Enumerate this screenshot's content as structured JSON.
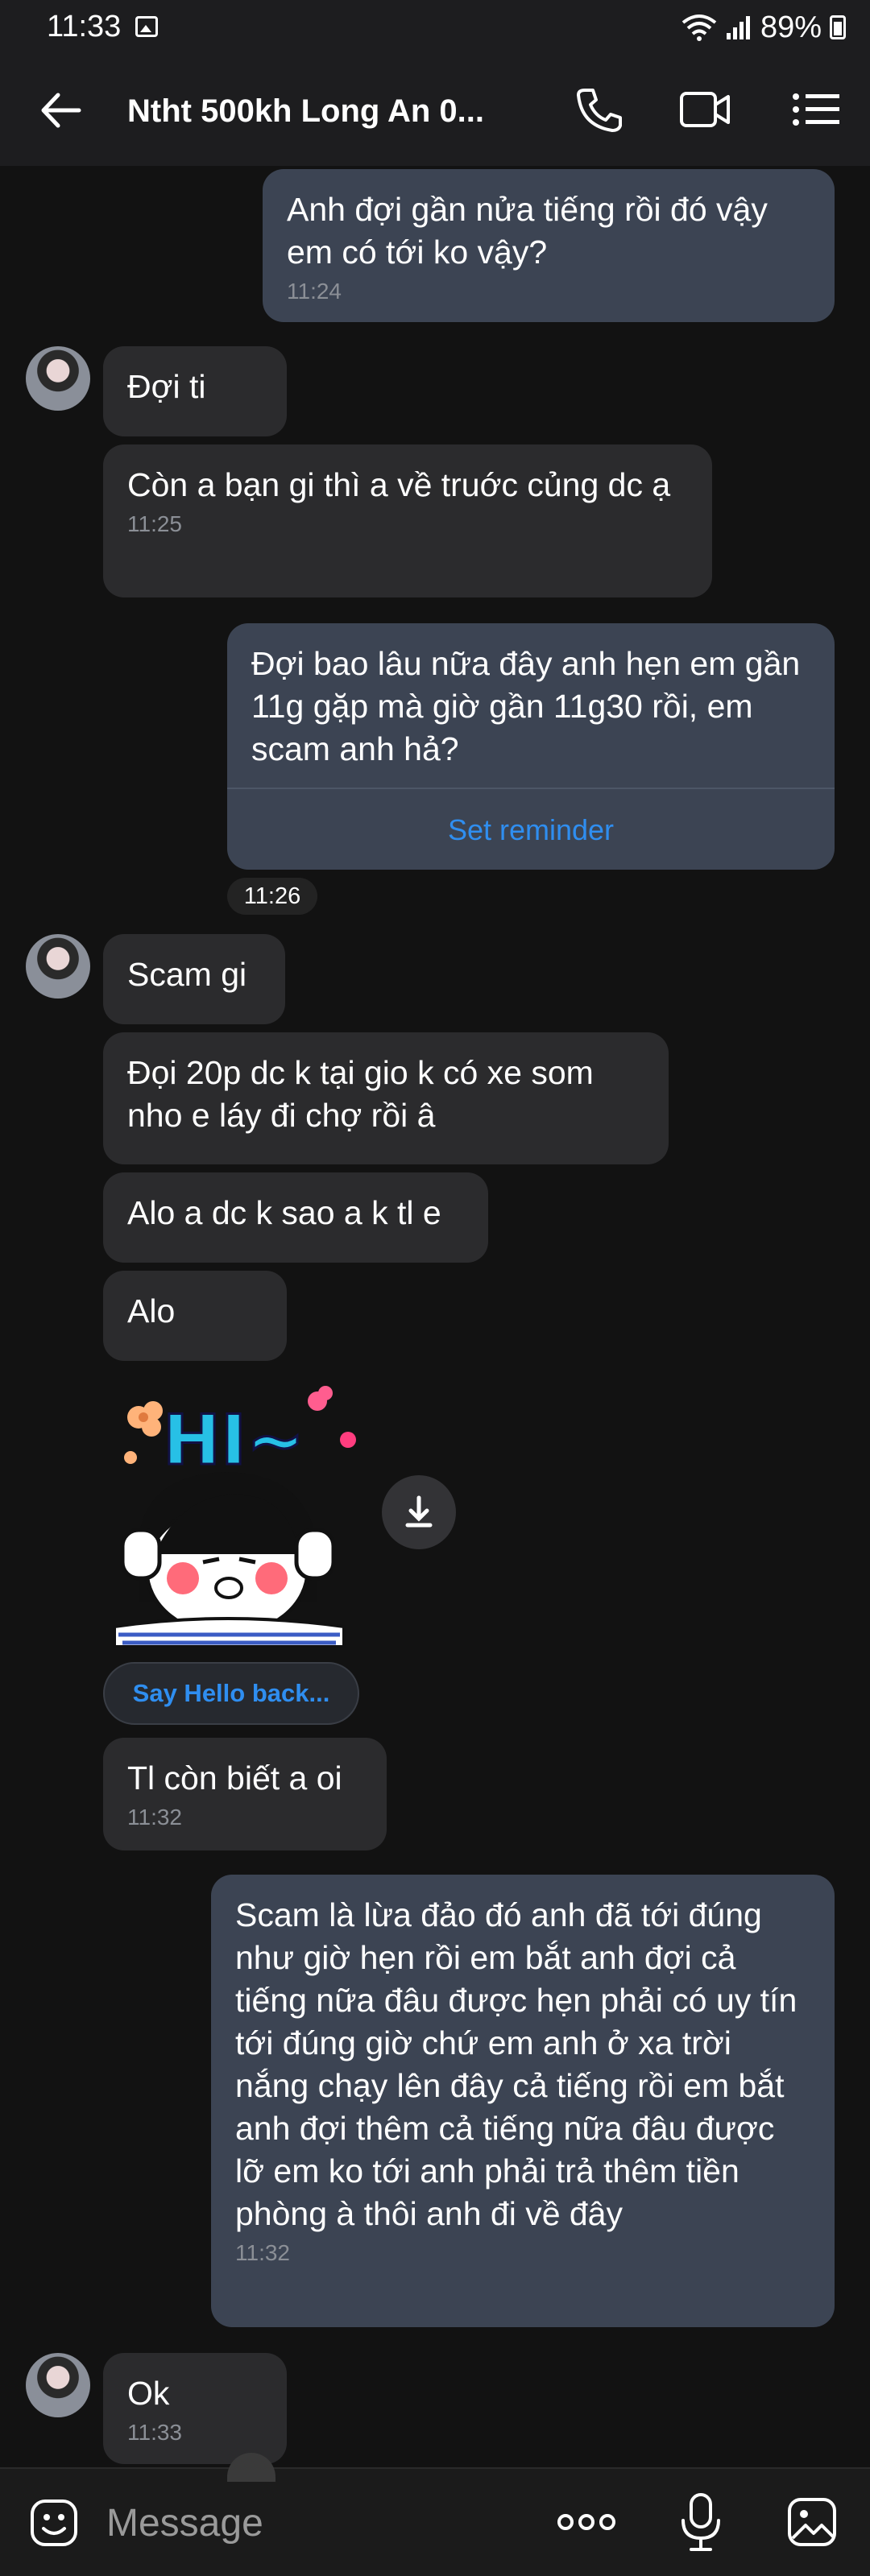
{
  "status_bar": {
    "time": "11:33",
    "battery": "89%"
  },
  "header": {
    "title": "Ntht 500kh Long An 0..."
  },
  "messages": [
    {
      "text": "Anh đợi gần nửa tiếng rồi đó vậy em có tới ko vậy?",
      "time": "11:24"
    },
    {
      "text": "Đợi ti"
    },
    {
      "text": "Còn a bạn gi thì a về truớc củng dc ạ",
      "time": "11:25"
    },
    {
      "text": "Đợi bao lâu nữa đây anh hẹn em gần 11g gặp mà giờ gần 11g30 rồi, em scam anh hả?",
      "reminder": "Set reminder"
    },
    {
      "time": "11:26"
    },
    {
      "text": "Scam gi"
    },
    {
      "text": "Đọi 20p dc k tại gio k có xe som nho e láy đi chợ rồi â"
    },
    {
      "text": "Alo a dc k sao a k tl e"
    },
    {
      "text": "Alo"
    },
    {
      "sticker_text": "HI~",
      "action": "Say Hello back..."
    },
    {
      "text": "Tl còn biết a oi",
      "time": "11:32"
    },
    {
      "text": "Scam là lừa đảo đó anh đã tới đúng như giờ hẹn rồi em bắt anh đợi cả tiếng nữa đâu được hẹn phải có uy tín tới đúng giờ chứ em anh ở xa trời nắng chạy lên đây cả tiếng rồi em bắt anh đợi thêm cả tiếng nữa đâu được lỡ em ko tới anh phải trả thêm tiền phòng à thôi anh đi về đây",
      "time": "11:32"
    },
    {
      "text": "Ok",
      "time": "11:33"
    }
  ],
  "composer": {
    "placeholder": "Message"
  }
}
